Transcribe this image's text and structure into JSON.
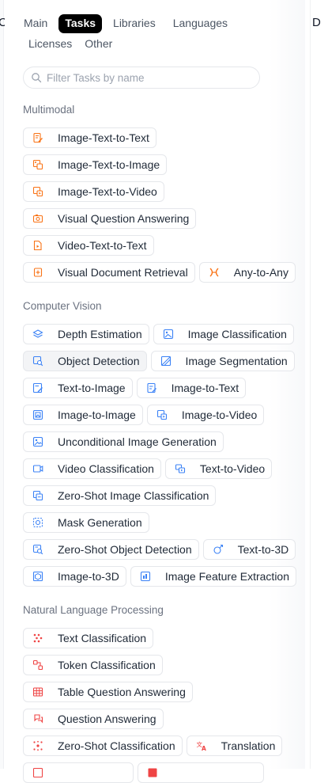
{
  "edges": {
    "left_fragment": "C",
    "right_fragment": "D"
  },
  "tabs": [
    {
      "label": "Main",
      "active": false
    },
    {
      "label": "Tasks",
      "active": true
    },
    {
      "label": "Libraries",
      "active": false
    },
    {
      "label": "Languages",
      "active": false
    },
    {
      "label": "Licenses",
      "active": false
    },
    {
      "label": "Other",
      "active": false
    }
  ],
  "search": {
    "placeholder": "Filter Tasks by name",
    "value": ""
  },
  "colors": {
    "multimodal": "#f97316",
    "computer_vision": "#3b82f6",
    "nlp": "#ef4444",
    "any_to_any": "#f97316"
  },
  "sections": {
    "multimodal": {
      "title": "Multimodal",
      "chips": [
        "Image-Text-to-Text",
        "Image-Text-to-Image",
        "Image-Text-to-Video",
        "Visual Question Answering",
        "Video-Text-to-Text",
        "Visual Document Retrieval",
        "Any-to-Any"
      ]
    },
    "computer_vision": {
      "title": "Computer Vision",
      "chips": [
        "Depth Estimation",
        "Image Classification",
        "Object Detection",
        "Image Segmentation",
        "Text-to-Image",
        "Image-to-Text",
        "Image-to-Image",
        "Image-to-Video",
        "Unconditional Image Generation",
        "Video Classification",
        "Text-to-Video",
        "Zero-Shot Image Classification",
        "Mask Generation",
        "Zero-Shot Object Detection",
        "Text-to-3D",
        "Image-to-3D",
        "Image Feature Extraction"
      ]
    },
    "nlp": {
      "title": "Natural Language Processing",
      "chips": [
        "Text Classification",
        "Token Classification",
        "Table Question Answering",
        "Question Answering",
        "Zero-Shot Classification",
        "Translation"
      ]
    }
  }
}
